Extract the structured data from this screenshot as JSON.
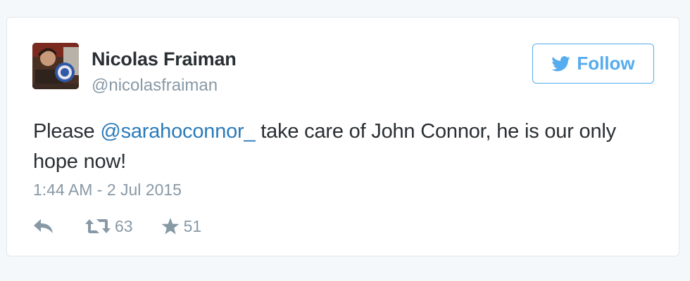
{
  "colors": {
    "page_background": "#f5f8fa",
    "card_background": "#ffffff",
    "card_border": "#e1e8ed",
    "name": "#292f33",
    "muted": "#8899a6",
    "brand_blue": "#55acee",
    "link": "#2b7bb9"
  },
  "tweet": {
    "author": {
      "name": "Nicolas Fraiman",
      "handle": "@nicolasfraiman",
      "avatar_icon": "profile-photo"
    },
    "follow": {
      "label": "Follow",
      "icon": "twitter-bird-icon"
    },
    "text": {
      "before_mention": "Please ",
      "mention": "@sarahoconnor_",
      "after_mention": " take care of John Connor, he is our only hope now!"
    },
    "timestamp": "1:44 AM - 2 Jul 2015",
    "actions": {
      "reply": {
        "icon": "reply-icon"
      },
      "retweet": {
        "icon": "retweet-icon",
        "count": "63"
      },
      "favorite": {
        "icon": "star-icon",
        "count": "51"
      }
    }
  }
}
